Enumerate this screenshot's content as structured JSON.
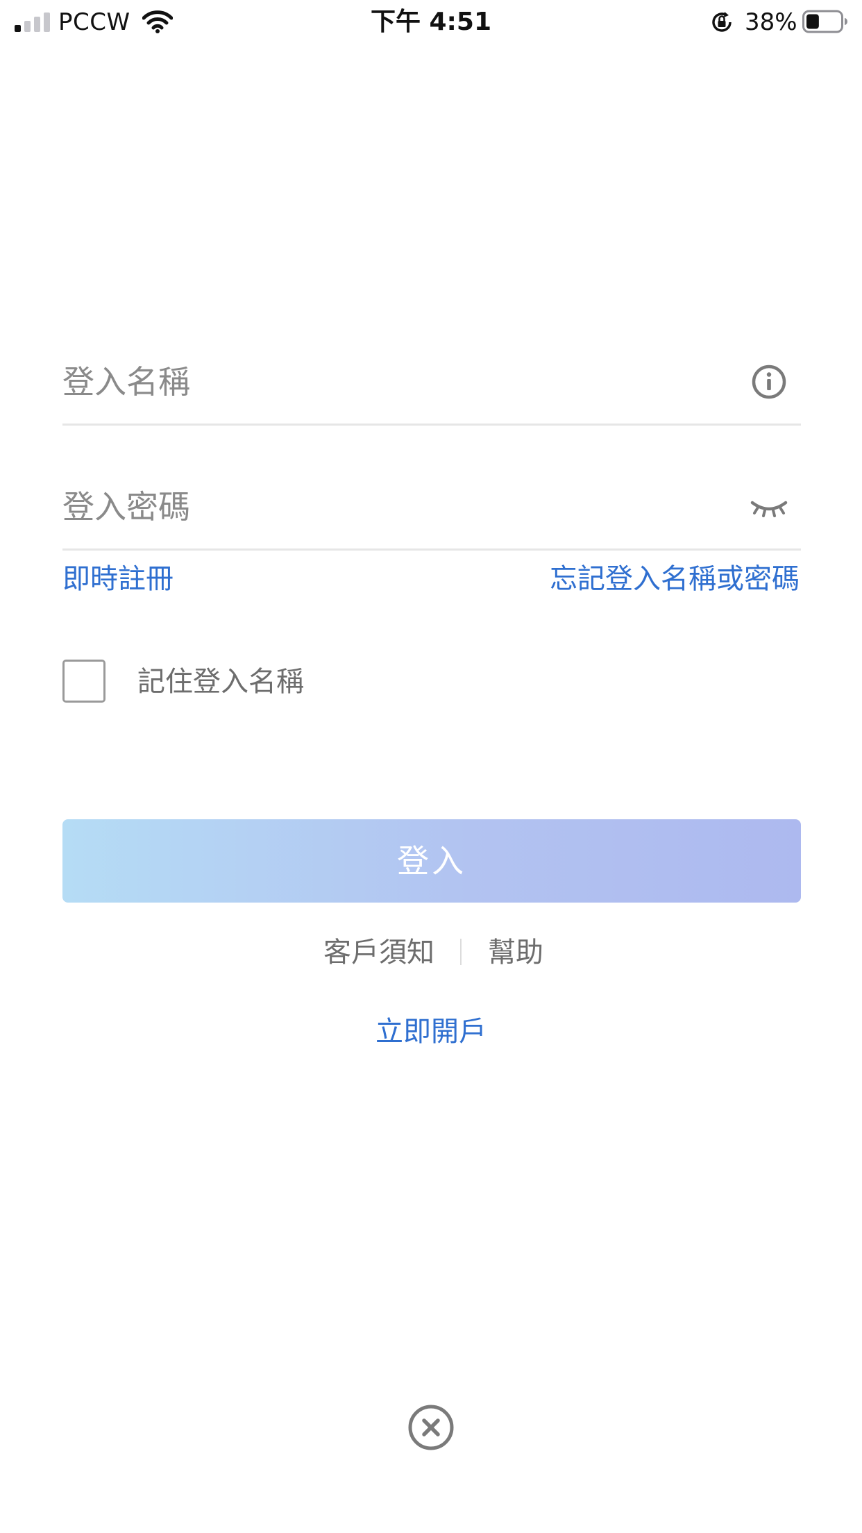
{
  "status_bar": {
    "carrier": "PCCW",
    "time": "下午 4:51",
    "battery_percent": "38%",
    "signal_bars_filled": 1,
    "signal_bars_total": 4,
    "battery_level": 0.38,
    "icons": {
      "signal": "cellular-signal-icon",
      "wifi": "wifi-icon",
      "orientation_lock": "orientation-lock-icon",
      "battery": "battery-icon"
    }
  },
  "login_form": {
    "username": {
      "placeholder": "登入名稱",
      "value": "",
      "icon": "info-icon"
    },
    "password": {
      "placeholder": "登入密碼",
      "value": "",
      "icon": "eye-closed-icon"
    },
    "register_link": "即時註冊",
    "forgot_link": "忘記登入名稱或密碼",
    "remember_label": "記住登入名稱",
    "remember_checked": false,
    "login_button": "登入"
  },
  "footer": {
    "customer_notice": "客戶須知",
    "help": "幫助",
    "open_account": "立即開戶"
  },
  "close_icon": "close-circle-icon",
  "colors": {
    "link": "#2f6fd0",
    "button_gradient_start": "#b5dcf5",
    "button_gradient_end": "#adb9ef",
    "muted_text": "#6d6d6d",
    "placeholder": "#8a8a8a",
    "divider": "#e6e6e6"
  }
}
